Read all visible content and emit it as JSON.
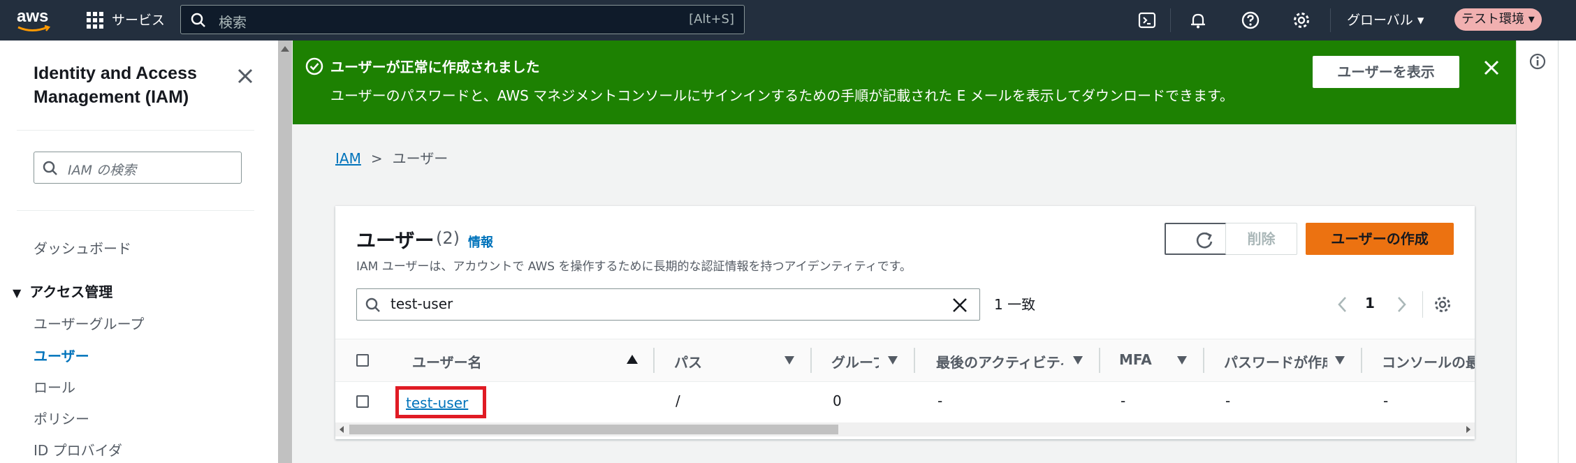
{
  "topbar": {
    "logo": "aws",
    "services_label": "サービス",
    "search_placeholder": "検索",
    "search_shortcut": "[Alt+S]",
    "region": "グローバル ▾",
    "environment": "テスト環境 ▾"
  },
  "nav": {
    "title": "Identity and Access Management (IAM)",
    "search_placeholder": "IAM の検索",
    "dashboard": "ダッシュボード",
    "section": "アクセス管理",
    "items": [
      {
        "label": "ユーザーグループ"
      },
      {
        "label": "ユーザー"
      },
      {
        "label": "ロール"
      },
      {
        "label": "ポリシー"
      },
      {
        "label": "ID プロバイダ"
      }
    ]
  },
  "flash": {
    "title": "ユーザーが正常に作成されました",
    "description": "ユーザーのパスワードと、AWS マネジメントコンソールにサインインするための手順が記載された E メールを表示してダウンロードできます。",
    "view_button": "ユーザーを表示",
    "color": "#1d8102"
  },
  "breadcrumb": {
    "root": "IAM",
    "current": "ユーザー"
  },
  "users": {
    "title": "ユーザー",
    "count": "(2)",
    "info": "情報",
    "description": "IAM ユーザーは、アカウントで AWS を操作するために長期的な認証情報を持つアイデンティティです。",
    "delete_button": "削除",
    "create_button": "ユーザーの作成",
    "filter_value": "test-user",
    "match_text": "1 一致",
    "page": "1",
    "columns": [
      "ユーザー名",
      "パス",
      "グループ",
      "最後のアクティビティ",
      "MFA",
      "パスワードが作成された時間",
      "コンソールの最終サインイン"
    ],
    "rows": [
      {
        "name": "test-user",
        "path": "/",
        "groups": "0",
        "last_activity": "-",
        "mfa": "-",
        "password_age": "-",
        "console_last": "-"
      }
    ]
  },
  "colors": {
    "topbar": "#232f3e",
    "accent": "#ec7211",
    "link": "#0073bb"
  }
}
